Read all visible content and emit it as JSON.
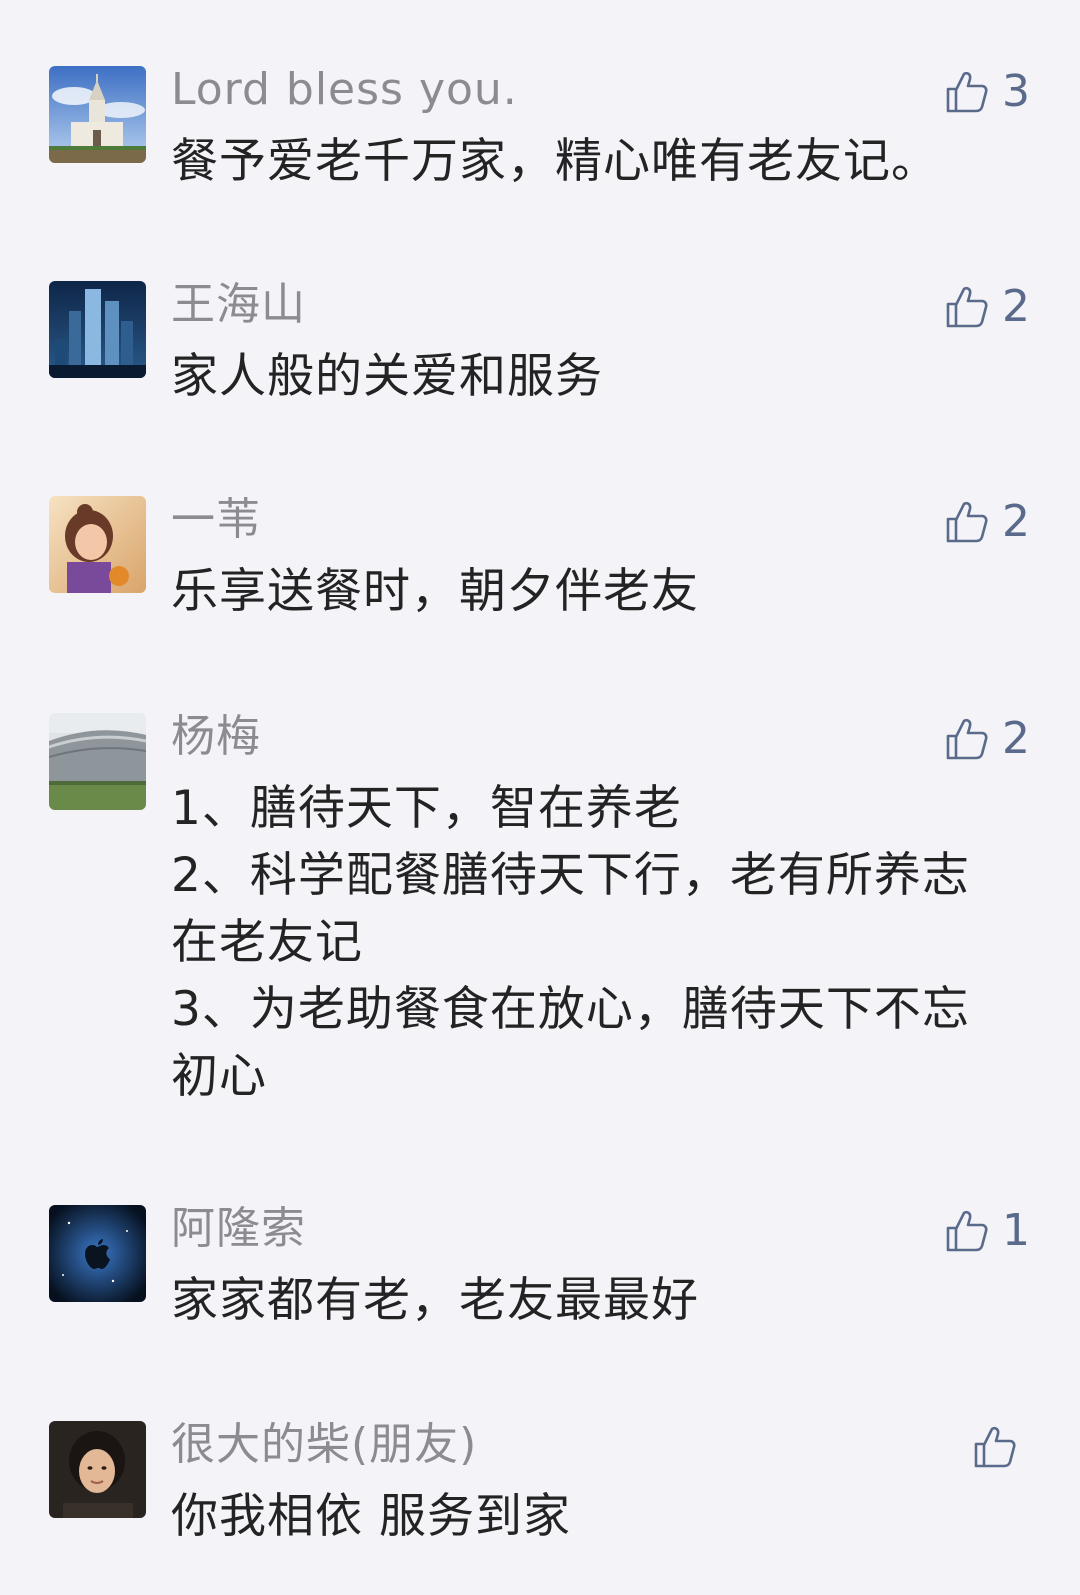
{
  "colors": {
    "background": "#f4f3f8",
    "name_text": "#8b8b90",
    "comment_text": "#232323",
    "like_accent": "#5a6a8a"
  },
  "comments": [
    {
      "avatar": "church-photo",
      "name": "Lord bless you.",
      "text": [
        "餐予爱老千万家，精心唯有老友记。"
      ],
      "like_icon": "thumbs-up-icon",
      "likes": "3"
    },
    {
      "avatar": "city-skyscraper-photo",
      "name": "王海山",
      "text": [
        "家人般的关爱和服务"
      ],
      "like_icon": "thumbs-up-icon",
      "likes": "2"
    },
    {
      "avatar": "girl-illustration",
      "name": "一苇",
      "text": [
        "乐享送餐时，朝夕伴老友"
      ],
      "like_icon": "thumbs-up-icon",
      "likes": "2"
    },
    {
      "avatar": "arena-building-photo",
      "name": "杨梅",
      "text": [
        "1、膳待天下，智在养老",
        "2、科学配餐膳待天下行，老有所养志",
        "在老友记",
        "3、为老助餐食在放心，膳待天下不忘",
        "初心"
      ],
      "like_icon": "thumbs-up-icon",
      "likes": "2"
    },
    {
      "avatar": "space-apple-logo",
      "name": "阿隆索",
      "text": [
        "家家都有老，老友最最好"
      ],
      "like_icon": "thumbs-up-icon",
      "likes": "1"
    },
    {
      "avatar": "person-portrait-photo",
      "name": "很大的柴(朋友)",
      "text": [
        "你我相依 服务到家"
      ],
      "like_icon": "thumbs-up-icon",
      "likes": ""
    }
  ]
}
